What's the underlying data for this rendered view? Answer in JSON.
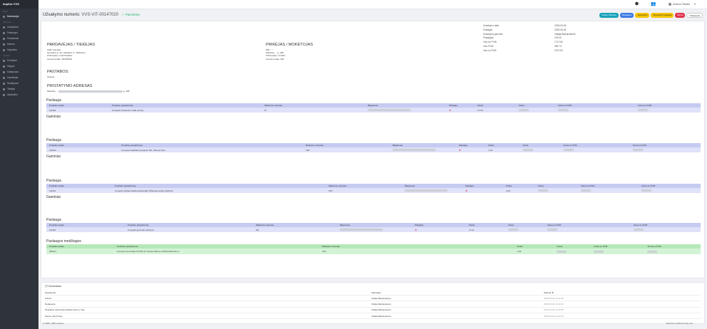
{
  "sidebar": {
    "brand": "Impilse VVS",
    "sections": [
      {
        "title": "Meniu",
        "items": [
          {
            "label": "Darbuotojai",
            "icon": "gauge-icon"
          }
        ]
      },
      {
        "title": "Valdymas",
        "items": [
          {
            "label": "Užsakymai",
            "icon": "cart-icon"
          },
          {
            "label": "Paslaugos",
            "icon": "wrench-icon"
          },
          {
            "label": "Pardavimai",
            "icon": "tag-icon"
          },
          {
            "label": "Klientai",
            "icon": "users-icon"
          },
          {
            "label": "Sąskaitos",
            "icon": "file-icon"
          }
        ]
      },
      {
        "title": "Sandėlis",
        "items": [
          {
            "label": "Produktai",
            "icon": "box-icon"
          },
          {
            "label": "Sklypai",
            "icon": "grid-icon"
          },
          {
            "label": "Kategorijos",
            "icon": "folder-icon"
          },
          {
            "label": "Gamintojai",
            "icon": "factory-icon"
          },
          {
            "label": "Nustatymai",
            "icon": "gear-icon"
          },
          {
            "label": "Tiekėjai",
            "icon": "truck-icon"
          },
          {
            "label": "Ataskaitos",
            "icon": "chart-icon"
          }
        ]
      }
    ]
  },
  "topbar": {
    "user_name": "Andrius Čikiskis"
  },
  "order": {
    "title_label": "Užsakymo numeris:",
    "number": "VVS-VIT-00147020",
    "status": "✓ Patvirtinta",
    "buttons": [
      "Siųsti į Klientus",
      "Redaguoti",
      "Spausdinti",
      "Spausdinti sąskaitą",
      "Ištrinti",
      "Užsakymai"
    ]
  },
  "seller": {
    "heading": "PARDAVĖJAS / TIEKĖJAS",
    "lines": [
      "UAB \"Impulsa\"",
      "Gamyklos g. 3G, Mažeikių m., Mažeikių r.",
      "PVM kodas: LT427310813",
      "Įmonės kodas: 187205091"
    ]
  },
  "notes": {
    "heading": "PASTABOS:",
    "text": "Išsiųsta"
  },
  "delivery": {
    "heading": "PRISTATYMO ADRESAS",
    "prefix": "Mažeikių ...",
    "suffix": "g. 14B"
  },
  "buyer": {
    "heading": "PIRKĖJAS / MOKĖTOJAS",
    "lines": [
      "MB \"...\"",
      "Mažeikių ... g. 14B",
      "PVM kodas: LT1004...",
      "Įmonės kodas: 300..."
    ]
  },
  "summary": [
    {
      "k": "Užsakymo data:",
      "v": "2025-05-06"
    },
    {
      "k": "Pabaigta:",
      "v": "2025-05-06"
    },
    {
      "k": "Užsakymą paruošė:",
      "v": "Vitalija Barkauskienė"
    },
    {
      "k": "Pabaigtas:",
      "v": "100.00"
    },
    {
      "k": "Viso be PVM:",
      "v": "1712.80"
    },
    {
      "k": "Viso PVM:",
      "v": "359.73"
    },
    {
      "k": "Viso su PVM:",
      "v": "2072.53"
    }
  ],
  "columns": [
    "Produkto kodas",
    "Produkto pavadinimas",
    "Matavimo vienetas",
    "Baigtumas",
    "Pabaigta",
    "Kiekis",
    "Kaina",
    "Kaina su PVM",
    "Suma su PVM"
  ],
  "sections": [
    {
      "title": "Paslauga",
      "row": {
        "code": "111118",
        "name": "Compact Suvarinimi CHE vamzių",
        "unit": "M",
        "qty": "17.50"
      },
      "footer": "Gaminiai"
    },
    {
      "title": "Paslauga",
      "row": {
        "code": "111004",
        "name": "Compact skalbiklis įrenginai, RS, Sutrupo finis",
        "unit": "VNT",
        "qty": "1.00"
      },
      "footer": "Gaminiai"
    },
    {
      "title": "Paslauga",
      "row": {
        "code": "111121",
        "name": "Compact skydas kabliamo(kraudiko (Šileopamos)as (žalofma",
        "unit": "VNT",
        "qty": "2.00"
      },
      "footer": "Gaminiai"
    },
    {
      "title": "Paslauga",
      "row": {
        "code": "111118",
        "name": "Compact įpavimas dažytinis",
        "unit": "M2",
        "qty": "11.11"
      },
      "footer": ""
    },
    {
      "title": "Paslaugos medžiagos",
      "row": {
        "code": "085021",
        "name": "Compact terminalas PONDI 24 Carrara Blanco 4303x1400x15mm",
        "unit": "VNT",
        "qty": "2.00"
      },
      "footer": "",
      "green": true
    }
  ],
  "comments": {
    "title": "Komentarai",
    "headers": [
      "Aprašymas",
      "Vartotojas",
      "Sukurta ▼"
    ],
    "rows": [
      [
        "Sukrito",
        "Vitalija Barkauskienė",
        "2025-05-06 11:11:38"
      ],
      [
        "Redaguota",
        "Vitalija Barkauskienė",
        "2025-05-06 11:03:43"
      ],
      [
        "Naujiųkas aatvirtintas laiškas Kliento: Taip",
        "Vitalija Barkauskienė",
        "2025-05-06 11:02:58"
      ],
      [
        "Kliento patvirtintas",
        "Vitalija Barkauskienė",
        "2025-05-06 11:02:25"
      ]
    ]
  },
  "footer": {
    "left": "© 2025, UAB Impulsa",
    "right": "Sukurta ir prižiūrima QC soft"
  }
}
